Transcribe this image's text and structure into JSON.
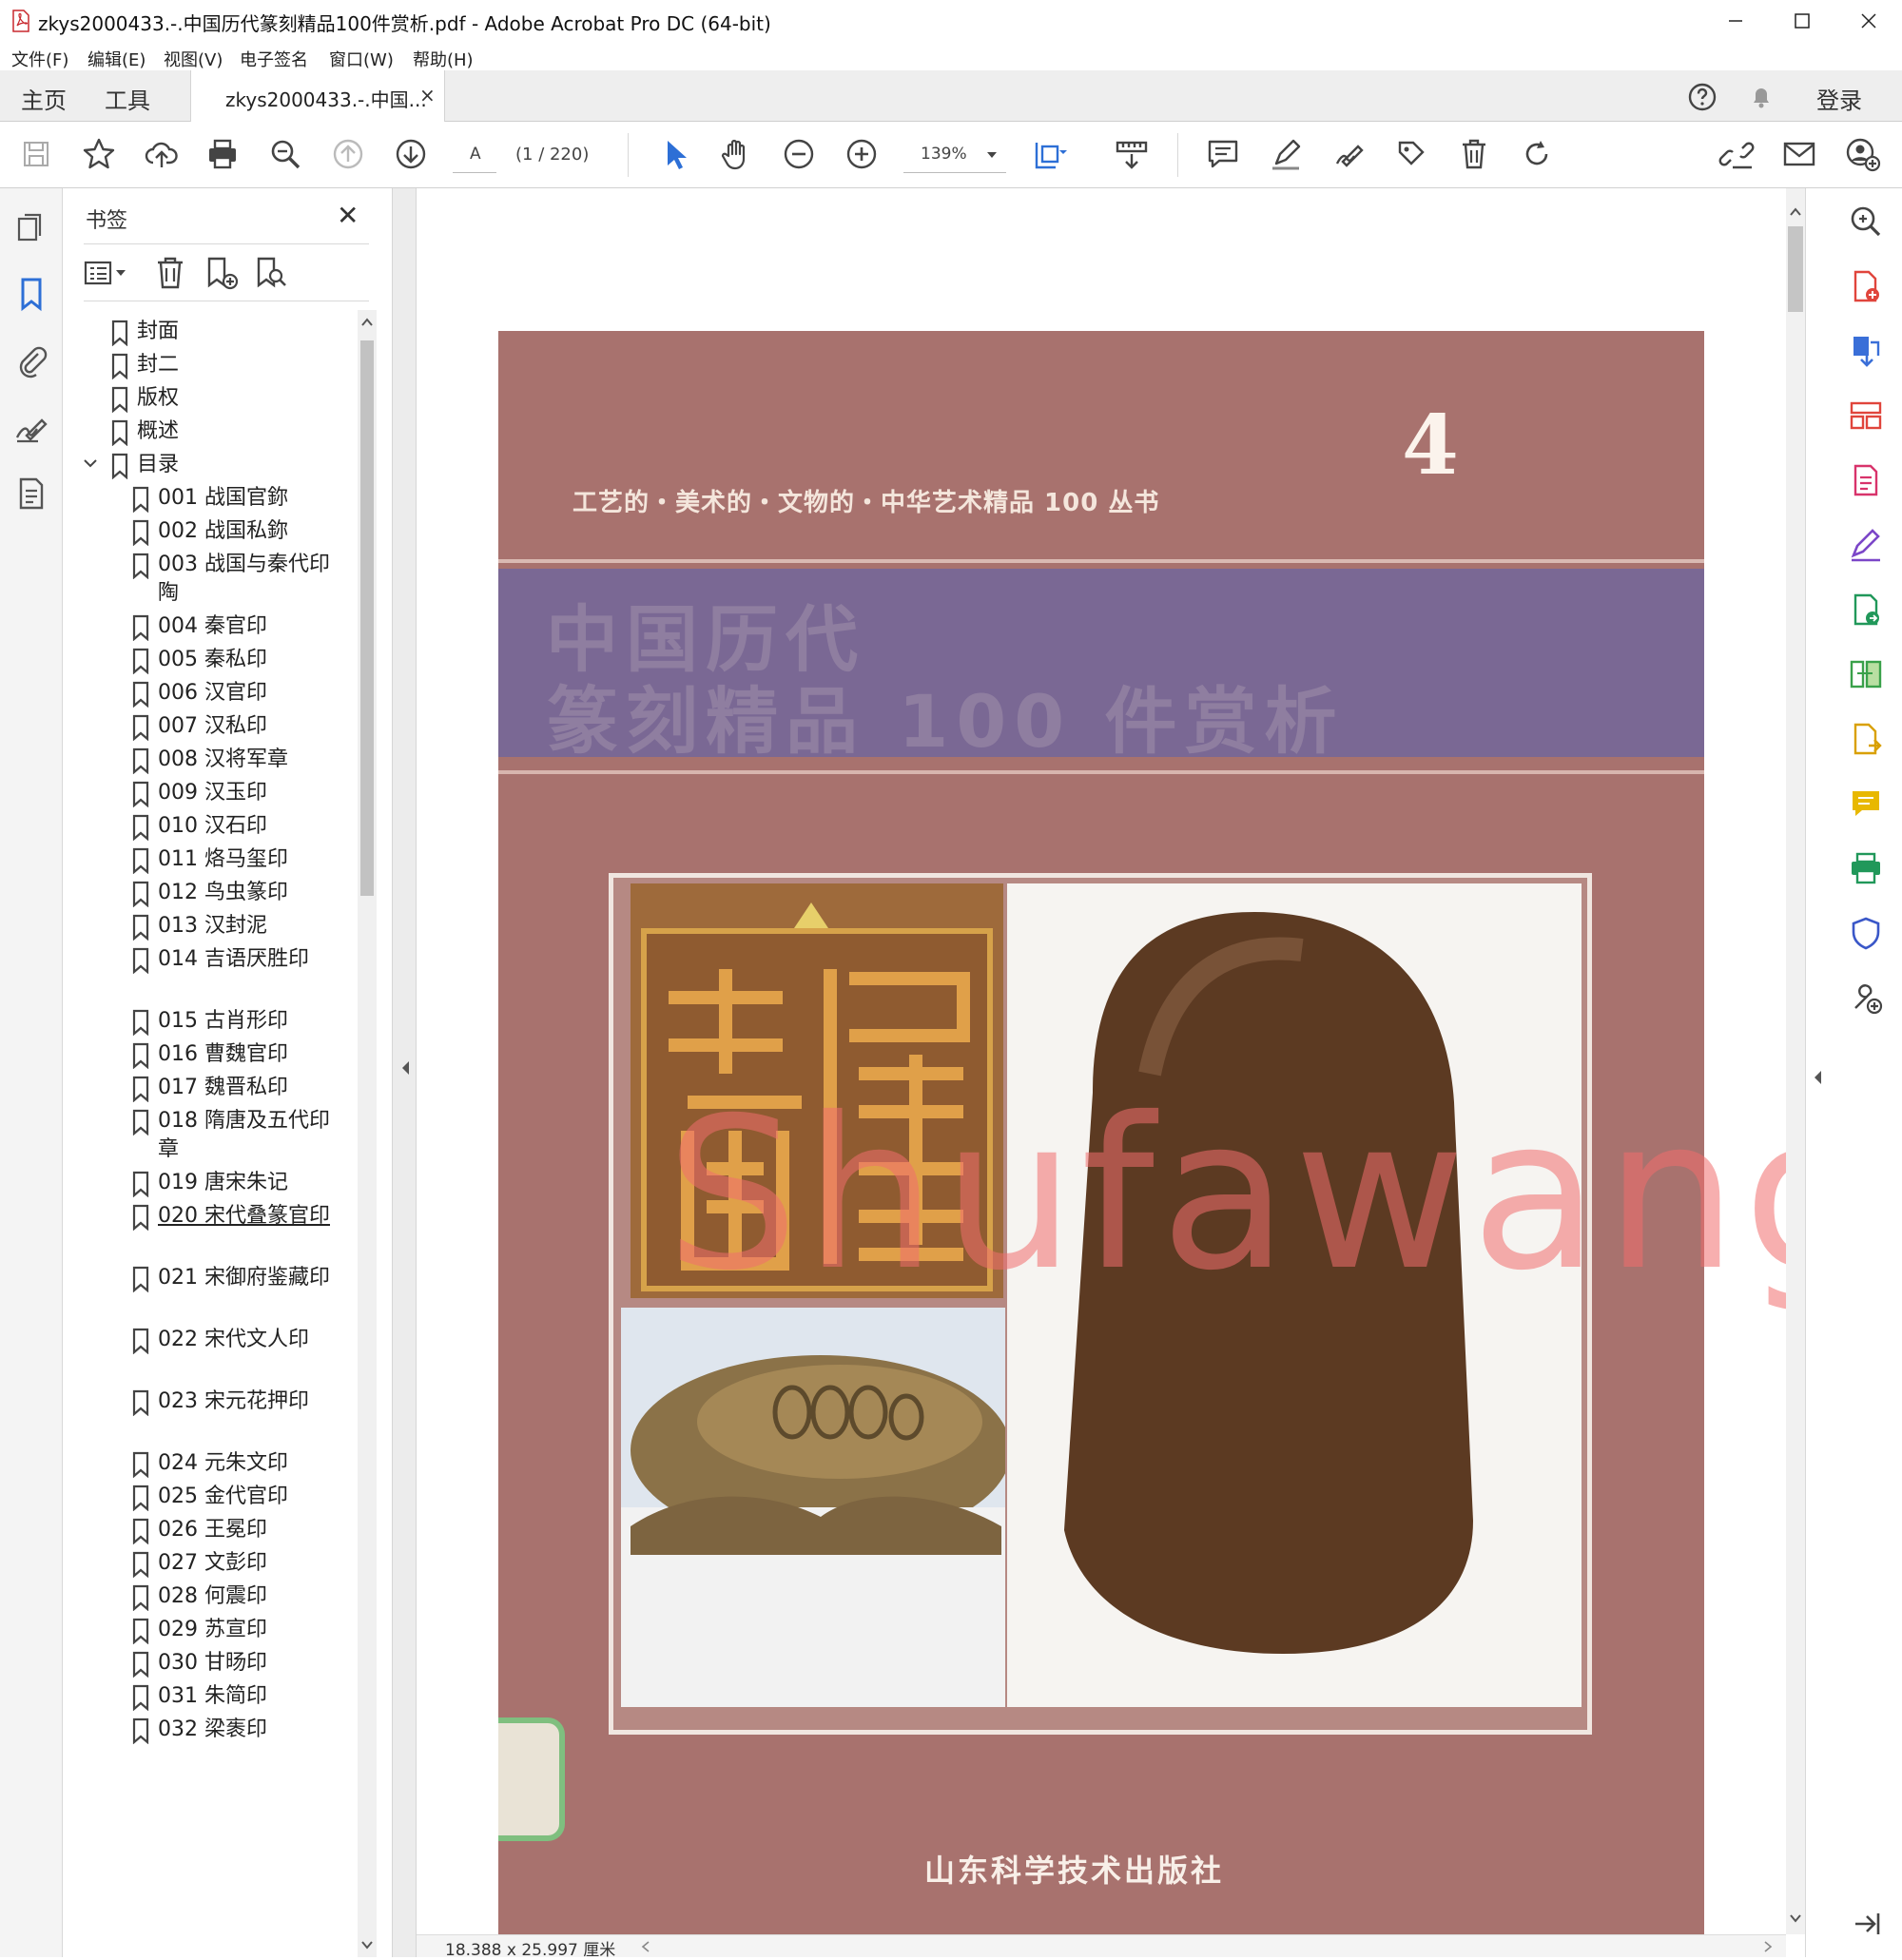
{
  "window": {
    "title": "zkys2000433.-.中国历代篆刻精品100件赏析.pdf - Adobe Acrobat Pro DC (64-bit)"
  },
  "menu": [
    "文件(F)",
    "编辑(E)",
    "视图(V)",
    "电子签名",
    "窗口(W)",
    "帮助(H)"
  ],
  "tabs": {
    "home": "主页",
    "tools": "工具",
    "document": "zkys2000433.-.中国...",
    "close_glyph": "×",
    "login": "登录"
  },
  "toolbar": {
    "page_input_placeholder": "A",
    "page_counter": "(1 / 220)",
    "zoom": "139%"
  },
  "bookmarks": {
    "title": "书签",
    "close_glyph": "✕",
    "items": [
      {
        "label": "封面",
        "level": 0
      },
      {
        "label": "封二",
        "level": 0
      },
      {
        "label": "版权",
        "level": 0
      },
      {
        "label": "概述",
        "level": 0
      },
      {
        "label": "目录",
        "level": 0,
        "expanded": true
      },
      {
        "label": "001 战国官鉨",
        "level": 1
      },
      {
        "label": "002 战国私鉨",
        "level": 1
      },
      {
        "label": "003 战国与秦代印陶",
        "level": 1
      },
      {
        "label": "004 秦官印",
        "level": 1
      },
      {
        "label": "005 秦私印",
        "level": 1
      },
      {
        "label": "006 汉官印",
        "level": 1
      },
      {
        "label": "007 汉私印",
        "level": 1
      },
      {
        "label": "008 汉将军章",
        "level": 1
      },
      {
        "label": "009 汉玉印",
        "level": 1
      },
      {
        "label": "010 汉石印",
        "level": 1
      },
      {
        "label": "011 烙马玺印",
        "level": 1
      },
      {
        "label": "012 鸟虫篆印",
        "level": 1
      },
      {
        "label": "013 汉封泥",
        "level": 1
      },
      {
        "label": "014 吉语厌胜印",
        "level": 1
      },
      {
        "label": "015 古肖形印",
        "level": 1
      },
      {
        "label": "016 曹魏官印",
        "level": 1
      },
      {
        "label": "017 魏晋私印",
        "level": 1
      },
      {
        "label": "018 隋唐及五代印章",
        "level": 1
      },
      {
        "label": "019 唐宋朱记",
        "level": 1
      },
      {
        "label": "020 宋代叠篆官印",
        "level": 1,
        "underlined": true
      },
      {
        "label": "021 宋御府鉴藏印",
        "level": 1
      },
      {
        "label": "022 宋代文人印",
        "level": 1
      },
      {
        "label": "023 宋元花押印",
        "level": 1
      },
      {
        "label": "024 元朱文印",
        "level": 1
      },
      {
        "label": "025 金代官印",
        "level": 1
      },
      {
        "label": "026 王冕印",
        "level": 1
      },
      {
        "label": "027 文彭印",
        "level": 1
      },
      {
        "label": "028 何震印",
        "level": 1
      },
      {
        "label": "029 苏宣印",
        "level": 1
      },
      {
        "label": "030 甘旸印",
        "level": 1
      },
      {
        "label": "031 朱简印",
        "level": 1
      },
      {
        "label": "032 梁袠印",
        "level": 1
      }
    ]
  },
  "document": {
    "volume_number": "4",
    "series_line": "工艺的・美术的・文物的・中华艺术精品 100 丛书",
    "title_line1": "中国历代",
    "title_line2": "篆刻精品 100 件赏析",
    "publisher": "山东科学技术出版社",
    "watermark": "Shufawang.CN",
    "page_size": "18.388 x 25.997 厘米"
  },
  "colors": {
    "accent_blue": "#2d6fd6",
    "cover_bg": "#a8726e",
    "title_band": "#7a6894"
  }
}
